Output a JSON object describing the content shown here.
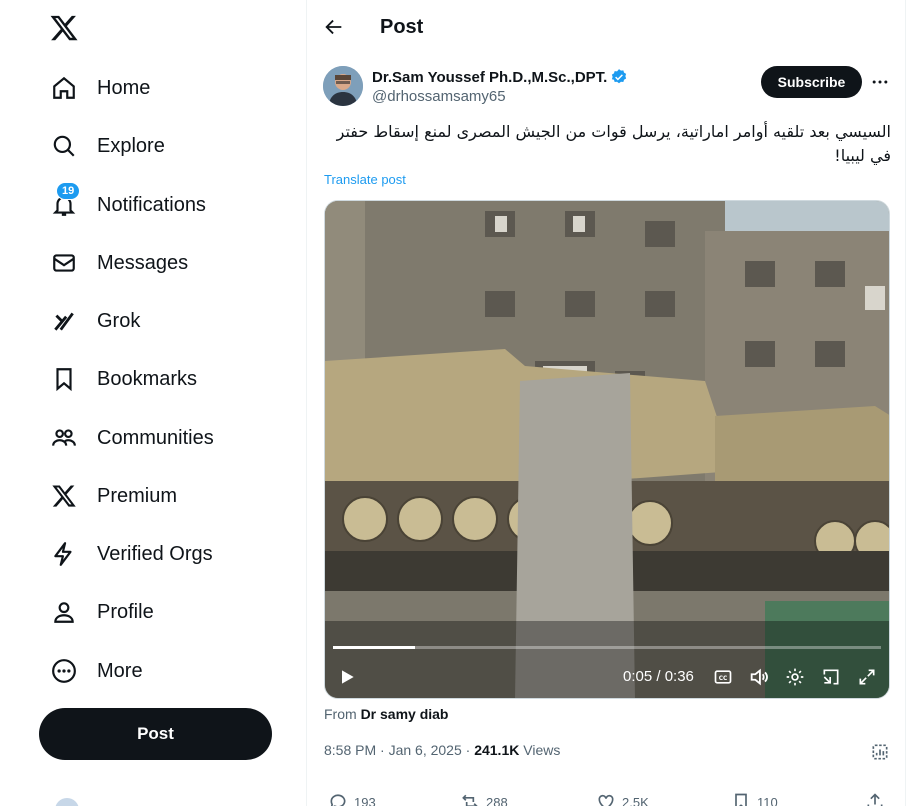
{
  "sidebar": {
    "logo": "x-logo-icon",
    "nav": [
      {
        "label": "Home",
        "icon": "home-icon"
      },
      {
        "label": "Explore",
        "icon": "search-icon"
      },
      {
        "label": "Notifications",
        "icon": "bell-icon",
        "badge": "19"
      },
      {
        "label": "Messages",
        "icon": "mail-icon"
      },
      {
        "label": "Grok",
        "icon": "grok-icon"
      },
      {
        "label": "Bookmarks",
        "icon": "bookmark-icon"
      },
      {
        "label": "Communities",
        "icon": "communities-icon"
      },
      {
        "label": "Premium",
        "icon": "x-logo-icon"
      },
      {
        "label": "Verified Orgs",
        "icon": "lightning-icon"
      },
      {
        "label": "Profile",
        "icon": "person-icon"
      },
      {
        "label": "More",
        "icon": "more-circle-icon"
      }
    ],
    "post_button": "Post"
  },
  "header": {
    "title": "Post"
  },
  "tweet": {
    "author_name": "Dr.Sam Youssef Ph.D.,M.Sc.,DPT.",
    "handle": "@drhossamsamy65",
    "subscribe_label": "Subscribe",
    "text": "السيسي بعد تلقيه أوامر اماراتية، يرسل قوات من الجيش المصرى لمنع إسقاط حفتر في ليبيا!",
    "translate_label": "Translate post",
    "video": {
      "time": "0:05 / 0:36",
      "progress": 0.15
    },
    "from_prefix": "From",
    "from_name": "Dr samy diab",
    "timestamp": "8:58 PM · Jan 6, 2025 ·",
    "views_count": "241.1K",
    "views_label": "Views",
    "actions": {
      "replies": "193",
      "reposts": "288",
      "likes": "2.5K",
      "bookmarks": "110"
    }
  },
  "colors": {
    "accent": "#1d9bf0",
    "text": "#0f1419",
    "muted": "#536471"
  }
}
